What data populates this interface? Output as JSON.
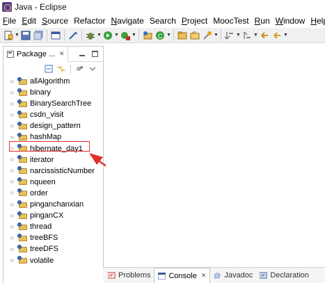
{
  "window": {
    "title": "Java - Eclipse"
  },
  "menubar": {
    "items": [
      {
        "mnemonic": "F",
        "rest": "ile"
      },
      {
        "mnemonic": "E",
        "rest": "dit"
      },
      {
        "mnemonic": "S",
        "rest": "ource"
      },
      {
        "mnemonic": "Refac",
        "rest": "tor",
        "ul_middle": true
      },
      {
        "mnemonic": "N",
        "rest": "avigate"
      },
      {
        "mnemonic": "Se",
        "rest": "arch",
        "ul_index": 1
      },
      {
        "mnemonic": "P",
        "rest": "roject"
      },
      {
        "mnemonic": "",
        "rest": "MoocTest"
      },
      {
        "mnemonic": "R",
        "rest": "un"
      },
      {
        "mnemonic": "W",
        "rest": "indow"
      },
      {
        "mnemonic": "H",
        "rest": "elp"
      }
    ],
    "labels": [
      "File",
      "Edit",
      "Source",
      "Refactor",
      "Navigate",
      "Search",
      "Project",
      "MoocTest",
      "Run",
      "Window",
      "Help"
    ]
  },
  "package_explorer": {
    "tab_label": "Package ...",
    "close_glyph": "✕",
    "projects": [
      "allAlgorithm",
      "binary",
      "BinarySearchTree",
      "csdn_visit",
      "design_pattern",
      "hashMap",
      "hibernate_day1",
      "iterator",
      "narcissisticNumber",
      "nqueen",
      "order",
      "pinganchanxian",
      "pinganCX",
      "thread",
      "treeBFS",
      "treeDFS",
      "volatile"
    ],
    "highlighted_project": "hibernate_day1",
    "annotation_color": "#e03030"
  },
  "bottom_panel": {
    "tabs": [
      {
        "label": "Problems",
        "active": false
      },
      {
        "label": "Console",
        "active": true
      },
      {
        "label": "Javadoc",
        "active": false
      },
      {
        "label": "Declaration",
        "active": false
      }
    ],
    "close_glyph": "✕"
  }
}
